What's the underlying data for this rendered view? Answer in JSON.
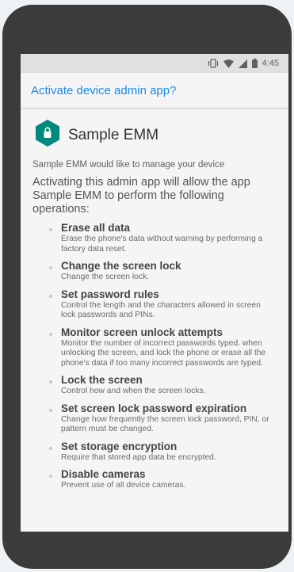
{
  "status_bar": {
    "time": "4:45",
    "icons": [
      "vibrate-icon",
      "wifi-icon",
      "signal-icon",
      "battery-icon"
    ]
  },
  "app_bar": {
    "title": "Activate device admin app?"
  },
  "admin_app": {
    "name": "Sample EMM",
    "icon": "lock-hexagon-icon",
    "icon_color": "#00897b",
    "intro": "Sample EMM would like to manage your device",
    "description": "Activating this admin app will allow the app Sample EMM to perform the following operations:"
  },
  "permissions": [
    {
      "title": "Erase all data",
      "desc": "Erase the phone's data without warning by performing a factory data reset."
    },
    {
      "title": "Change the screen lock",
      "desc": "Change the screen lock."
    },
    {
      "title": "Set password rules",
      "desc": "Control the length and the characters allowed in screen lock passwords and PINs."
    },
    {
      "title": "Monitor screen unlock attempts",
      "desc": "Monitor the number of incorrect passwords typed. when unlocking the screen, and lock the phone or erase all the phone's data if too many incorrect passwords are typed."
    },
    {
      "title": "Lock the screen",
      "desc": "Control how and when the screen locks."
    },
    {
      "title": "Set screen lock password expiration",
      "desc": "Change how frequently the screen lock password, PIN, or pattern must be changed."
    },
    {
      "title": "Set storage encryption",
      "desc": "Require that stored app data be encrypted."
    },
    {
      "title": "Disable cameras",
      "desc": "Prevent use of all device cameras."
    }
  ],
  "colors": {
    "accent": "#1e88e5",
    "phone_frame": "#3b3b3b"
  }
}
